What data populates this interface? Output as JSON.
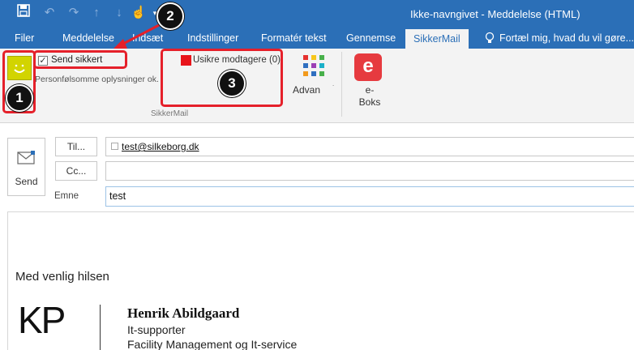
{
  "window": {
    "title": "Ikke-navngivet - Meddelelse (HTML)"
  },
  "quick_access": {
    "icons": [
      "save-icon",
      "undo-icon",
      "redo-icon",
      "up-arrow-icon",
      "down-arrow-icon",
      "touch-mode-icon"
    ]
  },
  "tabs": [
    {
      "label": "Filer"
    },
    {
      "label": "Meddelelse"
    },
    {
      "label": "Indsæt"
    },
    {
      "label": "Indstillinger"
    },
    {
      "label": "Formatér tekst"
    },
    {
      "label": "Gennemse"
    },
    {
      "label": "SikkerMail"
    }
  ],
  "tell_me": "Fortæl mig, hvad du vil gøre...",
  "ribbon": {
    "send_secure_label": "Send sikkert",
    "description": "Personfølsomme oplysninger ok.",
    "unsafe_recipients": "Usikre modtagere (0)",
    "group_label": "SikkerMail",
    "advan_label": "Advan",
    "eboks_letter": "e",
    "eboks_label_line1": "e-",
    "eboks_label_line2": "Boks"
  },
  "annotations": {
    "badge1": "1",
    "badge2": "2",
    "badge3": "3"
  },
  "compose": {
    "send_label": "Send",
    "to_button": "Til...",
    "cc_button": "Cc...",
    "subject_label": "Emne",
    "to_value": "test@silkeborg.dk",
    "cc_value": "",
    "subject_value": "test"
  },
  "body": {
    "greeting": "Med venlig hilsen",
    "logo_text": "KP",
    "sig_name": "Henrik Abildgaard",
    "sig_role": "It-supporter",
    "sig_dept": "Facility Management og It-service"
  },
  "colors": {
    "titlebar": "#2b6fb7",
    "annotation": "#e5202a",
    "smiley": "#d2d400",
    "eboks": "#e63a3f"
  }
}
